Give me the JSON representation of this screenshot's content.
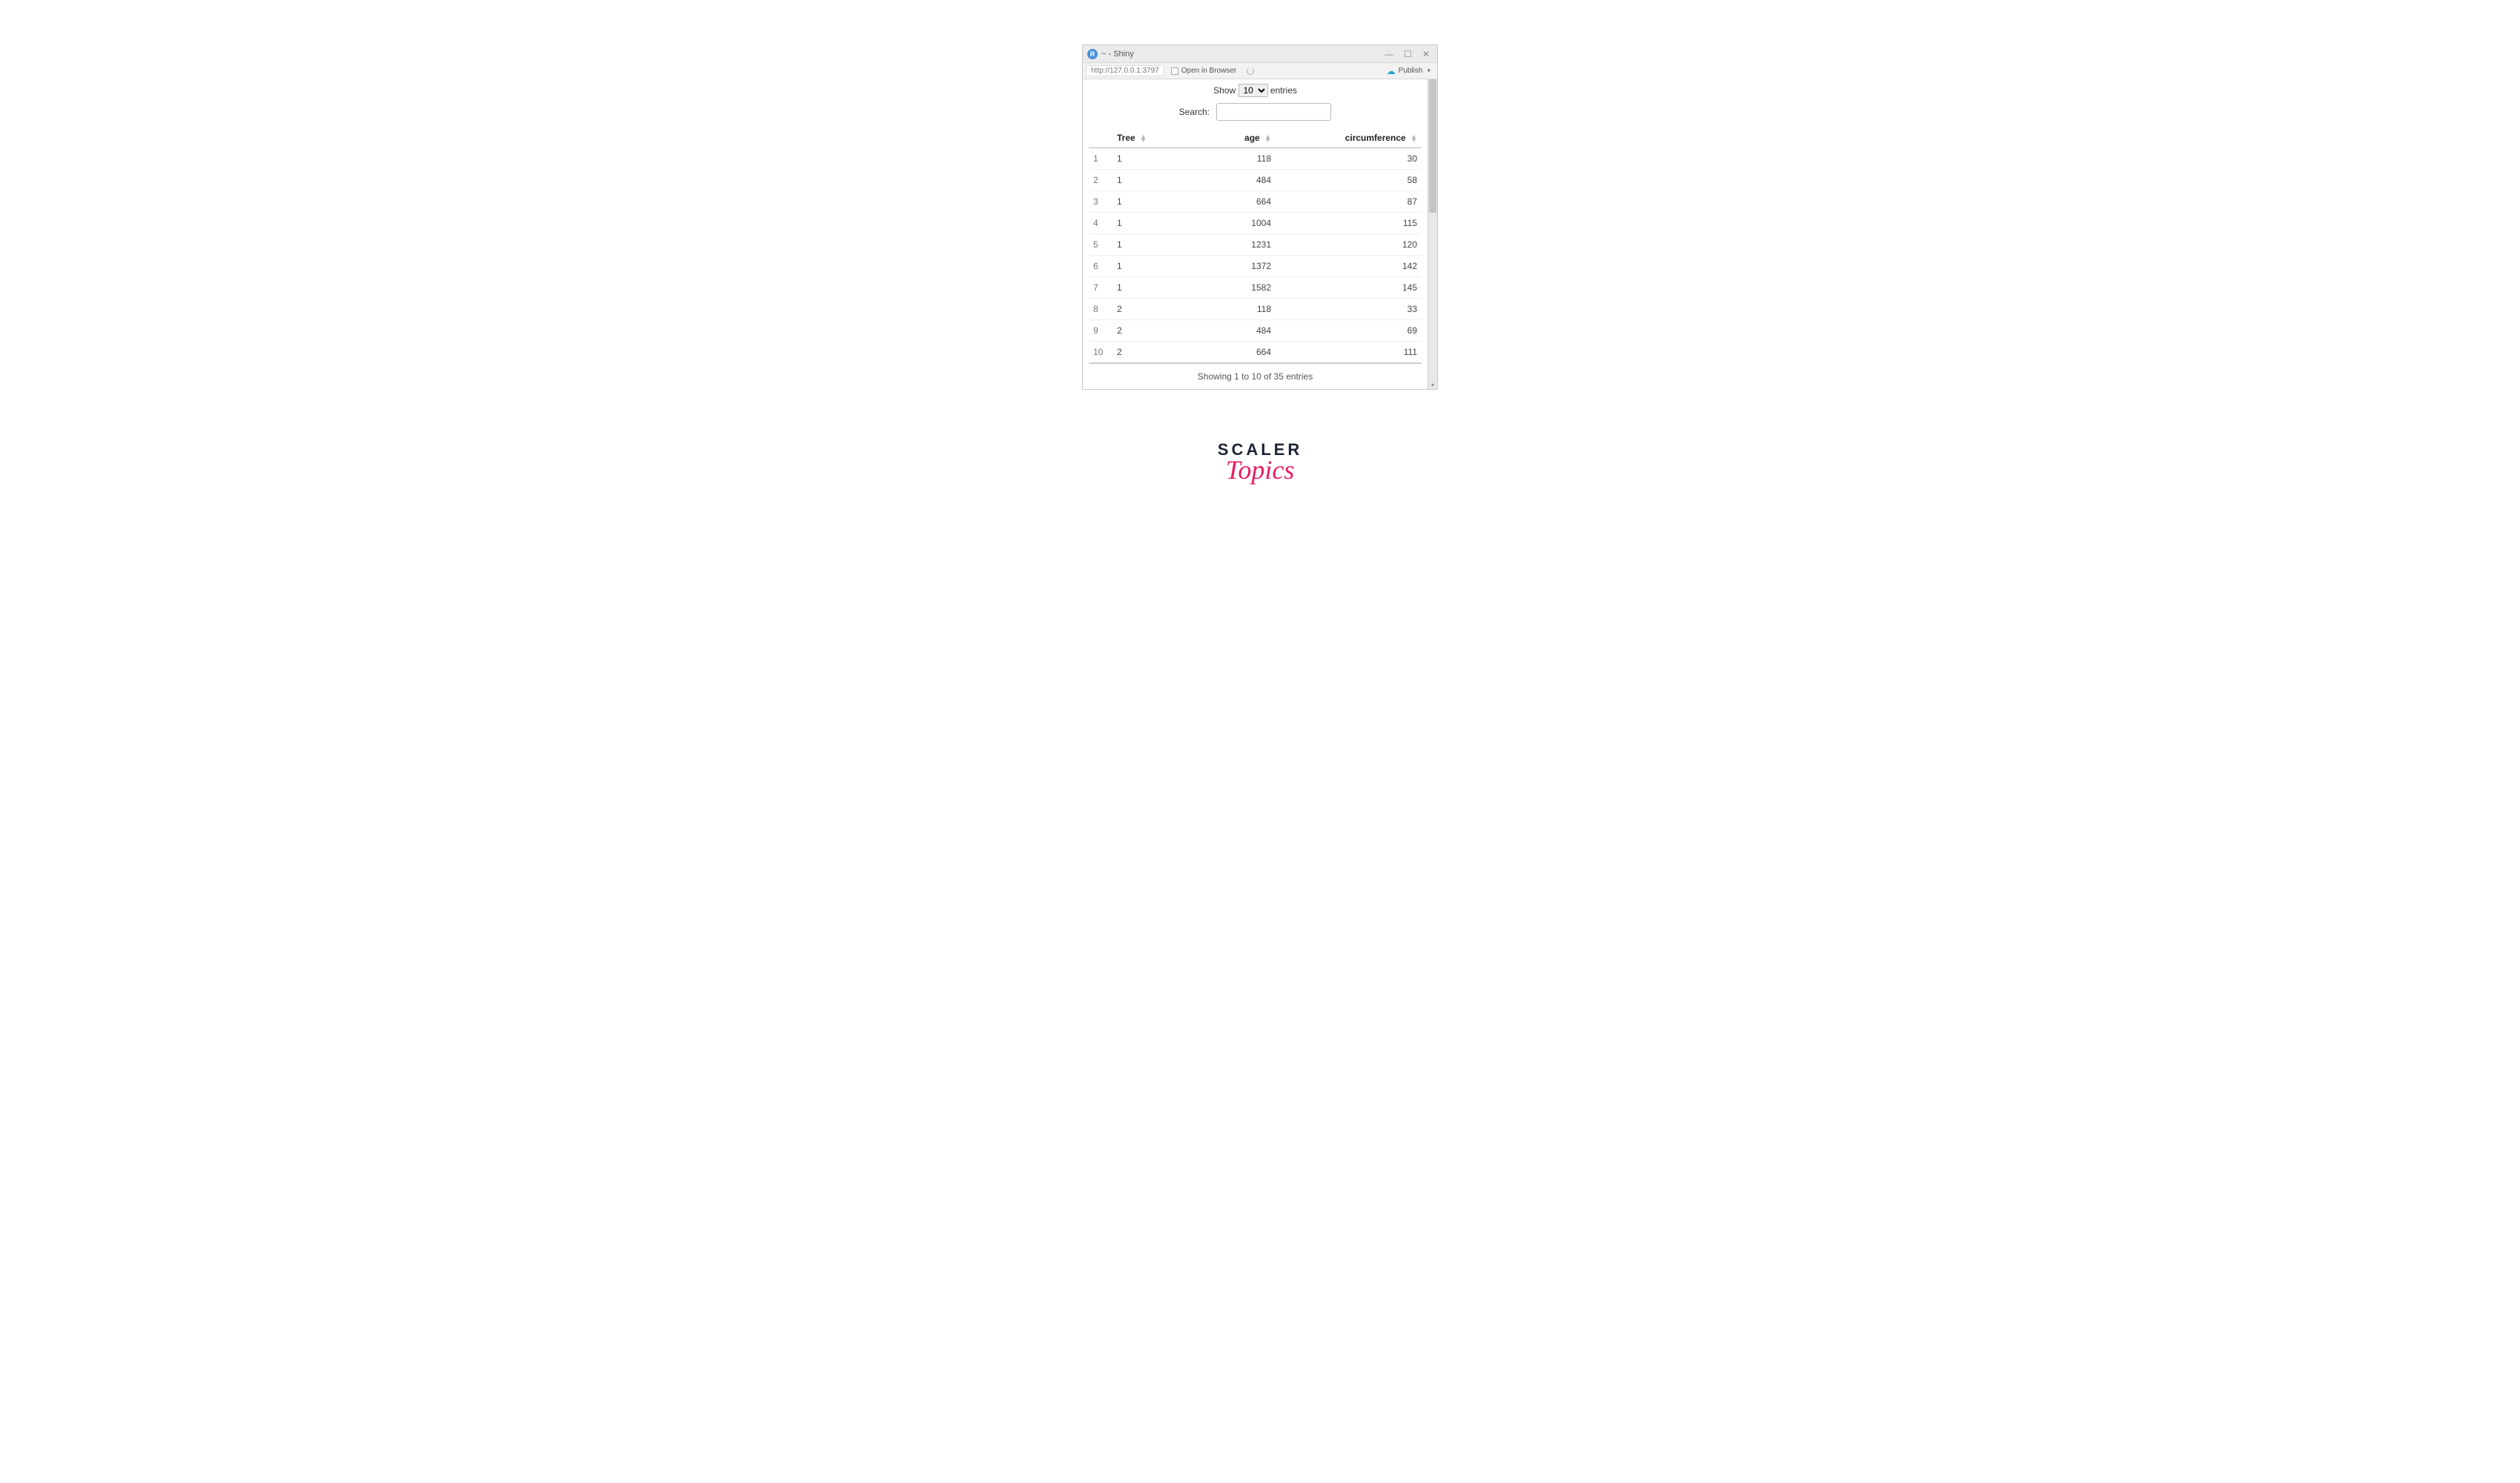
{
  "window": {
    "title": "~ - Shiny",
    "icon_letter": "R"
  },
  "toolbar": {
    "url": "http://127.0.0.1:3797",
    "open_browser_label": "Open in Browser",
    "publish_label": "Publish"
  },
  "datatable": {
    "show_label_prefix": "Show",
    "show_value": "10",
    "show_label_suffix": "entries",
    "search_label": "Search:",
    "columns": [
      "",
      "Tree",
      "age",
      "circumference"
    ],
    "rows": [
      {
        "idx": "1",
        "tree": "1",
        "age": "118",
        "circ": "30"
      },
      {
        "idx": "2",
        "tree": "1",
        "age": "484",
        "circ": "58"
      },
      {
        "idx": "3",
        "tree": "1",
        "age": "664",
        "circ": "87"
      },
      {
        "idx": "4",
        "tree": "1",
        "age": "1004",
        "circ": "115"
      },
      {
        "idx": "5",
        "tree": "1",
        "age": "1231",
        "circ": "120"
      },
      {
        "idx": "6",
        "tree": "1",
        "age": "1372",
        "circ": "142"
      },
      {
        "idx": "7",
        "tree": "1",
        "age": "1582",
        "circ": "145"
      },
      {
        "idx": "8",
        "tree": "2",
        "age": "118",
        "circ": "33"
      },
      {
        "idx": "9",
        "tree": "2",
        "age": "484",
        "circ": "69"
      },
      {
        "idx": "10",
        "tree": "2",
        "age": "664",
        "circ": "111"
      }
    ],
    "footer": "Showing 1 to 10 of 35 entries"
  },
  "brand": {
    "line1": "SCALER",
    "line2": "Topics"
  }
}
